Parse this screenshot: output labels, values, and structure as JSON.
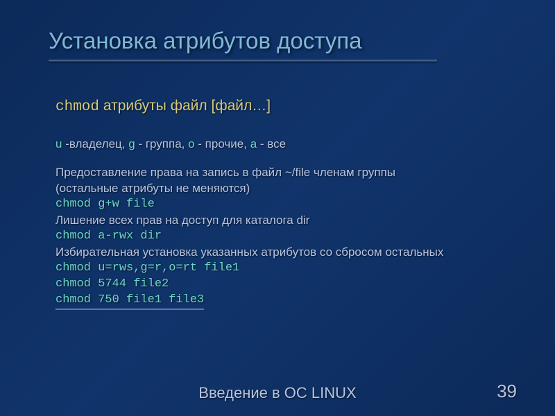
{
  "title": "Установка атрибутов доступа",
  "syntax": {
    "cmd": "chmod",
    "args": "атрибуты файл [файл…]"
  },
  "who": {
    "u_key": "u",
    "u_desc": " -владелец, ",
    "g_key": "g",
    "g_desc": " - группа, ",
    "o_key": "o",
    "o_desc": " - прочие, ",
    "a_key": "a",
    "a_desc": " - все"
  },
  "lines": {
    "l1": "Предоставление права на запись в файл ~/file членам группы",
    "l2": "(остальные атрибуты не меняются)",
    "c1": "chmod g+w file",
    "l3": "Лишение всех прав на доступ для каталога dir",
    "c2": "chmod a-rwx dir",
    "l4": "Избирательная установка указанных атрибутов со сбросом остальных",
    "c3": "chmod u=rws,g=r,o=rt file1",
    "c4": "chmod 5744 file2",
    "c5": "chmod 750 file1 file3"
  },
  "footer": "Введение в ОС LINUX",
  "page_number": "39"
}
